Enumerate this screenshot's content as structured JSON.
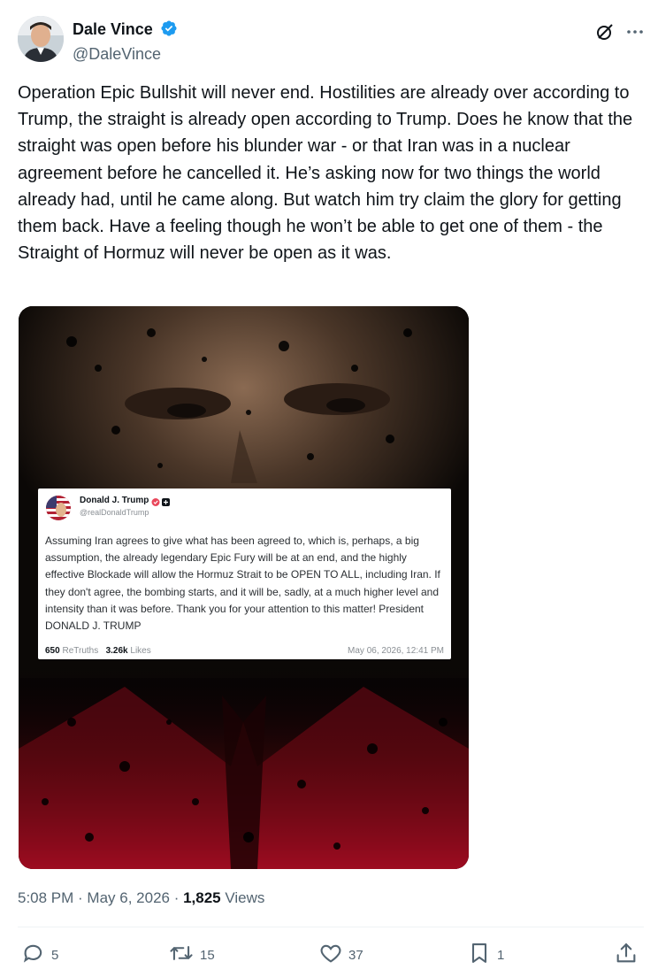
{
  "author": {
    "display_name": "Dale Vince",
    "handle": "@DaleVince",
    "verified": true
  },
  "post": {
    "text": "Operation Epic Bullshit will never end. Hostilities are already over according to Trump, the straight is already open according to Trump. Does he know that the straight was open before his blunder war - or that Iran was in a nuclear agreement before he cancelled it. He’s asking now for two things the world already had, until he came along. But watch him try claim the glory for getting them back. Have a feeling though he won’t be able to get one of them - the Straight of Hormuz will never be open as it was."
  },
  "embedded_post": {
    "display_name": "Donald J. Trump",
    "handle": "@realDonaldTrump",
    "text": "Assuming Iran agrees to give what has been agreed to, which is, perhaps, a big assumption, the already legendary Epic Fury will be at an end, and the highly effective Blockade will allow the Hormuz Strait to be OPEN TO ALL, including Iran. If they don't agree, the bombing starts, and it will be, sadly, at a much higher level and intensity than it was before. Thank you for your attention to this matter! President DONALD J. TRUMP",
    "retruths_count": "650",
    "retruths_label": "ReTruths",
    "likes_count": "3.26k",
    "likes_label": "Likes",
    "date": "May 06, 2026, 12:41 PM"
  },
  "meta": {
    "time": "5:08 PM",
    "sep1": " · ",
    "date": "May 6, 2026",
    "sep2": " · ",
    "views_count": "1,825",
    "views_label": " Views"
  },
  "actions": {
    "replies": "5",
    "reposts": "15",
    "likes": "37",
    "bookmarks": "1"
  },
  "colors": {
    "verified_blue": "#1d9bf0",
    "icon_gray": "#536471",
    "accent_red": "#c8102e"
  }
}
